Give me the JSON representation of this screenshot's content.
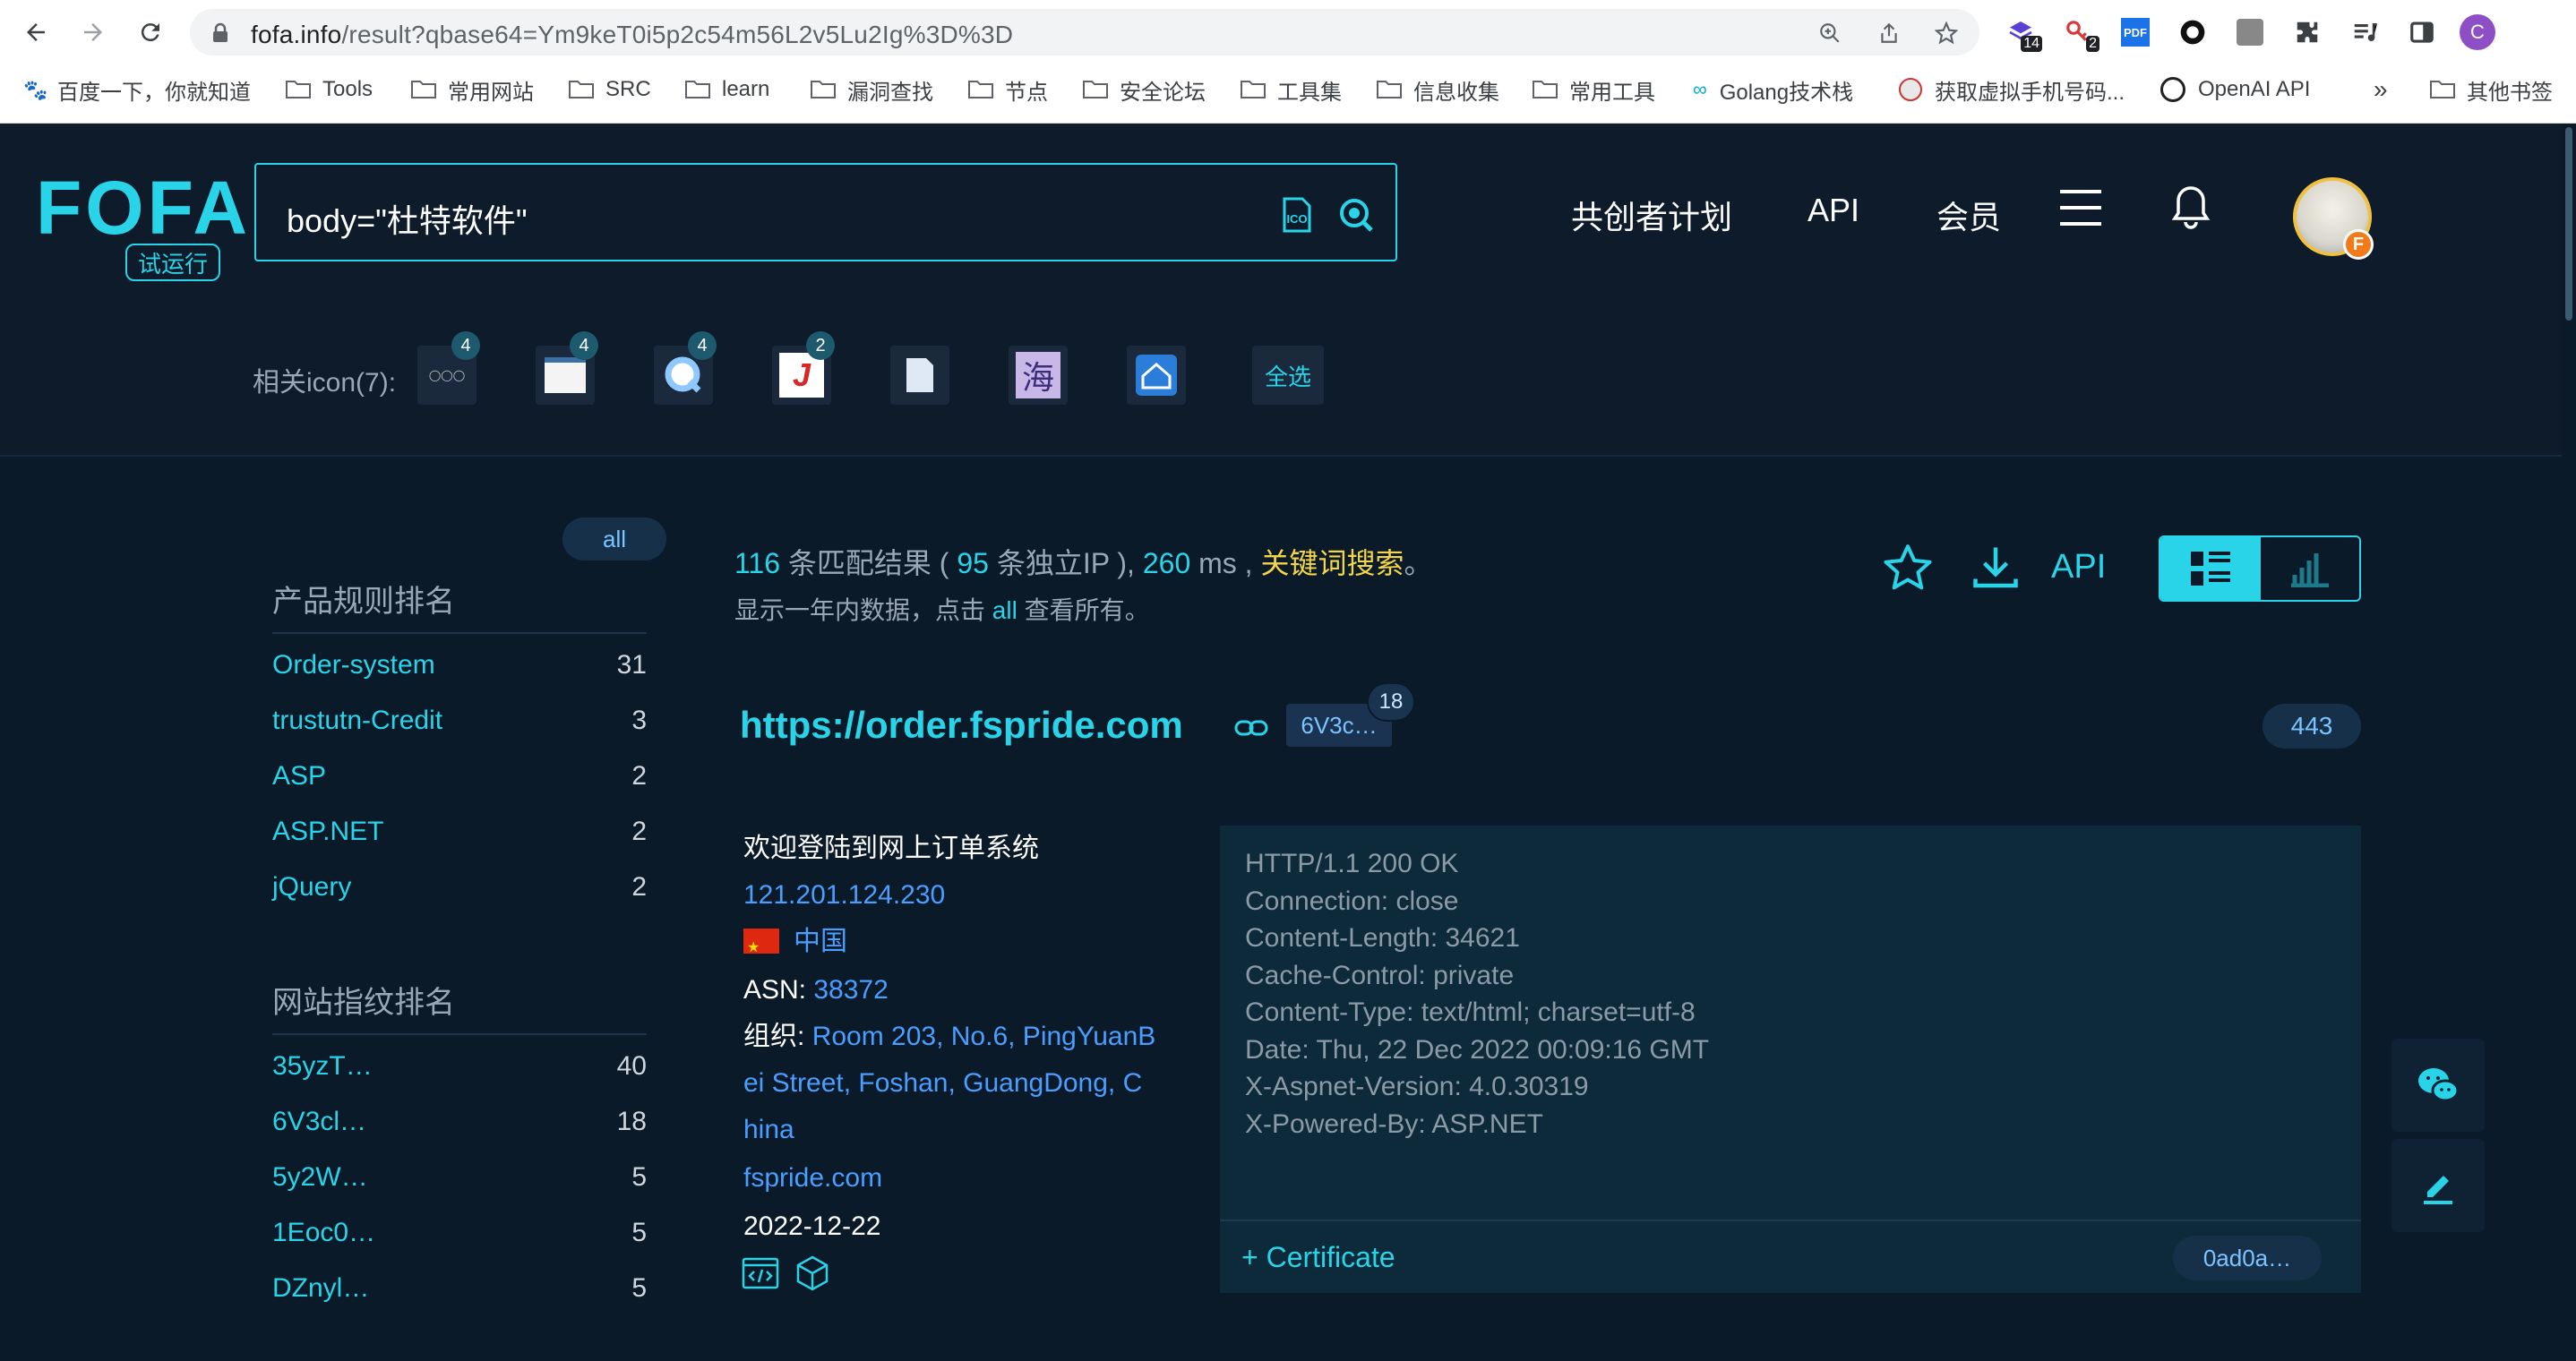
{
  "browser": {
    "url_host": "fofa.info",
    "url_path": "/result?qbase64=Ym9keT0i5p2c54m56L2v5Lu2Ig%3D%3D",
    "extension_badges": [
      "14",
      "2"
    ],
    "pdf_label": "PDF",
    "profile_initial": "C",
    "bookmarks": [
      "百度一下，你就知道",
      "Tools",
      "常用网站",
      "SRC",
      "learn",
      "漏洞查找",
      "节点",
      "安全论坛",
      "工具集",
      "信息收集",
      "常用工具",
      "Golang技术栈",
      "获取虚拟手机号码...",
      "OpenAI API"
    ],
    "more_bookmarks": "»",
    "other_bookmarks": "其他书签"
  },
  "header": {
    "logo": "FOFA",
    "logo_tag": "试运行",
    "query": "body=\"杜特软件\"",
    "nav": [
      "共创者计划",
      "API",
      "会员"
    ],
    "avatar_badge": "F"
  },
  "related_icons": {
    "label": "相关icon(7):",
    "counts": [
      "4",
      "4",
      "4",
      "2"
    ],
    "select_all": "全选"
  },
  "sidebar": {
    "all_pill": "all",
    "product_title": "产品规则排名",
    "products": [
      {
        "name": "Order-system",
        "count": "31"
      },
      {
        "name": "trustutn-Credit",
        "count": "3"
      },
      {
        "name": "ASP",
        "count": "2"
      },
      {
        "name": "ASP.NET",
        "count": "2"
      },
      {
        "name": "jQuery",
        "count": "2"
      }
    ],
    "fingerprint_title": "网站指纹排名",
    "fingerprints": [
      {
        "name": "35yzT…",
        "count": "40"
      },
      {
        "name": "6V3cl…",
        "count": "18"
      },
      {
        "name": "5y2W…",
        "count": "5"
      },
      {
        "name": "1Eoc0…",
        "count": "5"
      },
      {
        "name": "DZnyl…",
        "count": "5"
      }
    ]
  },
  "summary": {
    "count": "116",
    "count_label": "条匹配结果 (",
    "unique_ip": "95",
    "ip_label": "条独立IP ),",
    "ms": "260",
    "ms_label": "ms ,",
    "keyword": "关键词搜索",
    "end": "。",
    "sub_before": "显示一年内数据，点击",
    "sub_link": "all",
    "sub_after": "查看所有。",
    "api_label": "API"
  },
  "result": {
    "url": "https://order.fspride.com",
    "hash_tag": "6V3c…",
    "hash_count": "18",
    "port": "443",
    "title": "欢迎登陆到网上订单系统",
    "ip": "121.201.124.230",
    "country": "中国",
    "asn_label": "ASN:",
    "asn": "38372",
    "org_label": "组织:",
    "org_line1": "Room 203, No.6, PingYuanB",
    "org_line2": "ei Street, Foshan, GuangDong, C",
    "org_line3": "hina",
    "domain": "fspride.com",
    "date": "2022-12-22",
    "headers": "HTTP/1.1 200 OK\nConnection: close\nContent-Length: 34621\nCache-Control: private\nContent-Type: text/html; charset=utf-8\nDate: Thu, 22 Dec 2022 00:09:16 GMT\nX-Aspnet-Version: 4.0.30319\nX-Powered-By: ASP.NET",
    "cert_label": "+ Certificate",
    "cert_hash": "0ad0a…"
  },
  "colors": {
    "accent": "#29d3e8",
    "background": "#0b1a29",
    "keyword": "#f3d54a",
    "link": "#4a9eff"
  }
}
